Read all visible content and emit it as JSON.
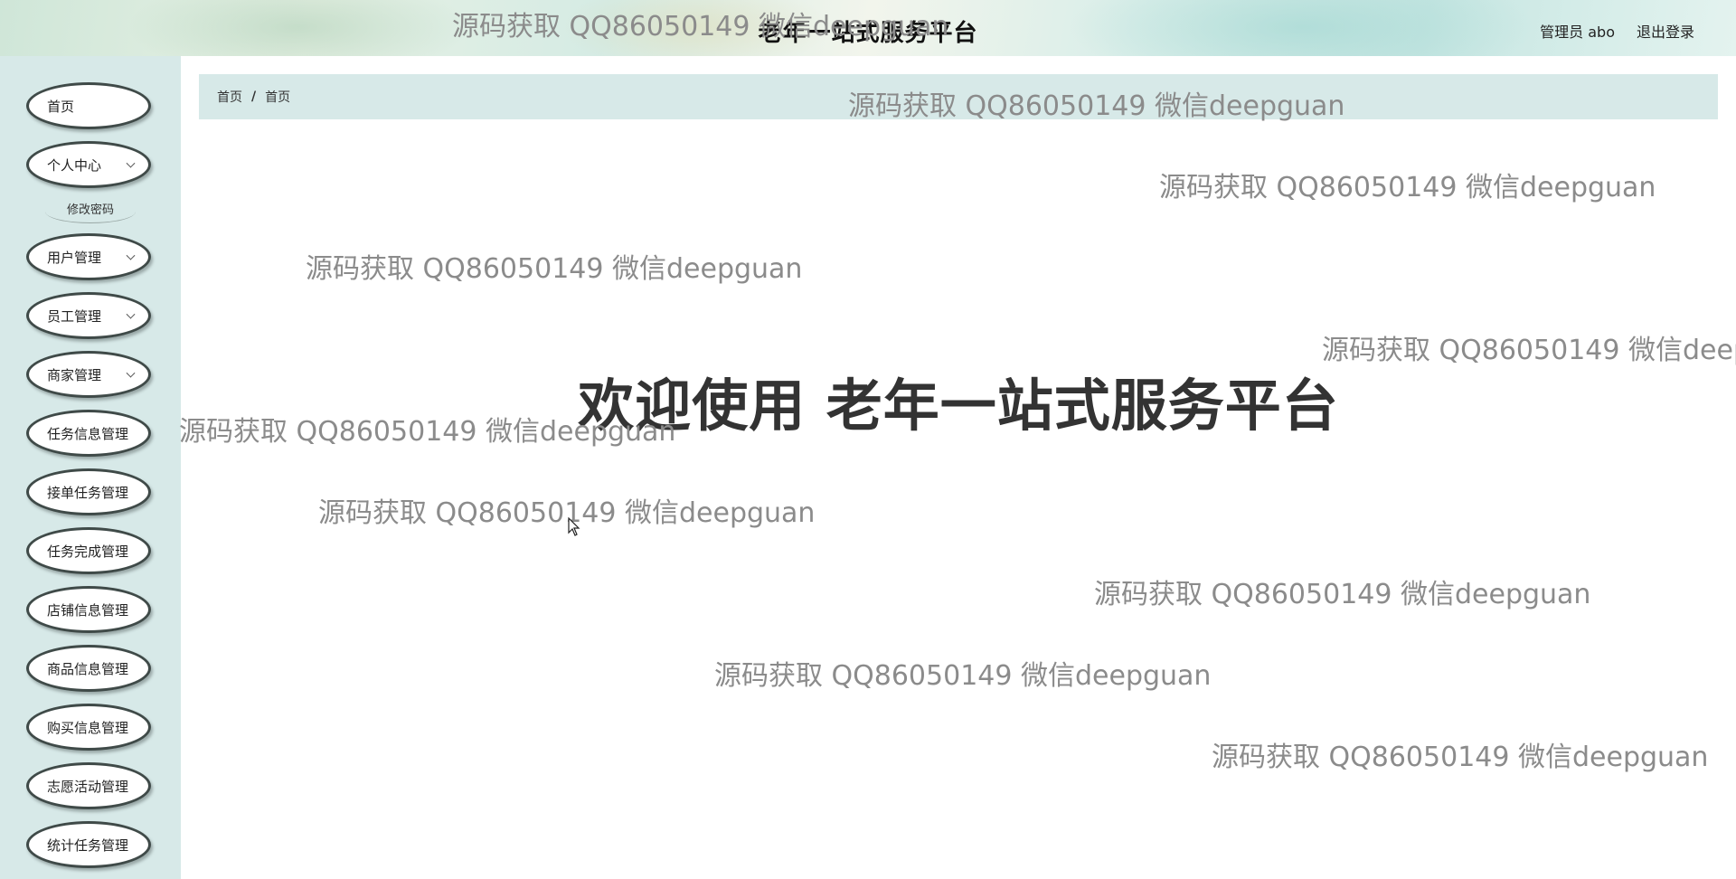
{
  "header": {
    "title": "老年一站式服务平台",
    "user": "管理员 abo",
    "logout": "退出登录"
  },
  "sidebar": {
    "items": [
      {
        "label": "首页",
        "expandable": false
      },
      {
        "label": "个人中心",
        "expandable": true
      },
      {
        "label": "修改密码",
        "submenu": true
      },
      {
        "label": "用户管理",
        "expandable": true
      },
      {
        "label": "员工管理",
        "expandable": true
      },
      {
        "label": "商家管理",
        "expandable": true
      },
      {
        "label": "任务信息管理",
        "expandable": false
      },
      {
        "label": "接单任务管理",
        "expandable": false
      },
      {
        "label": "任务完成管理",
        "expandable": false
      },
      {
        "label": "店铺信息管理",
        "expandable": false
      },
      {
        "label": "商品信息管理",
        "expandable": false
      },
      {
        "label": "购买信息管理",
        "expandable": false
      },
      {
        "label": "志愿活动管理",
        "expandable": false
      },
      {
        "label": "统计任务管理",
        "expandable": false
      }
    ]
  },
  "breadcrumb": {
    "items": [
      "首页",
      "首页"
    ],
    "separator": "/"
  },
  "main": {
    "welcome": "欢迎使用 老年一站式服务平台"
  },
  "watermark": {
    "text": "源码获取 QQ86050149 微信deepguan"
  },
  "colors": {
    "sidebar_bg": "#d7e9e8",
    "breadcrumb_bg": "#d7e9e8",
    "menu_border": "#3f4a48",
    "welcome_text": "#333333",
    "watermark_text": "#8b8b8b"
  }
}
